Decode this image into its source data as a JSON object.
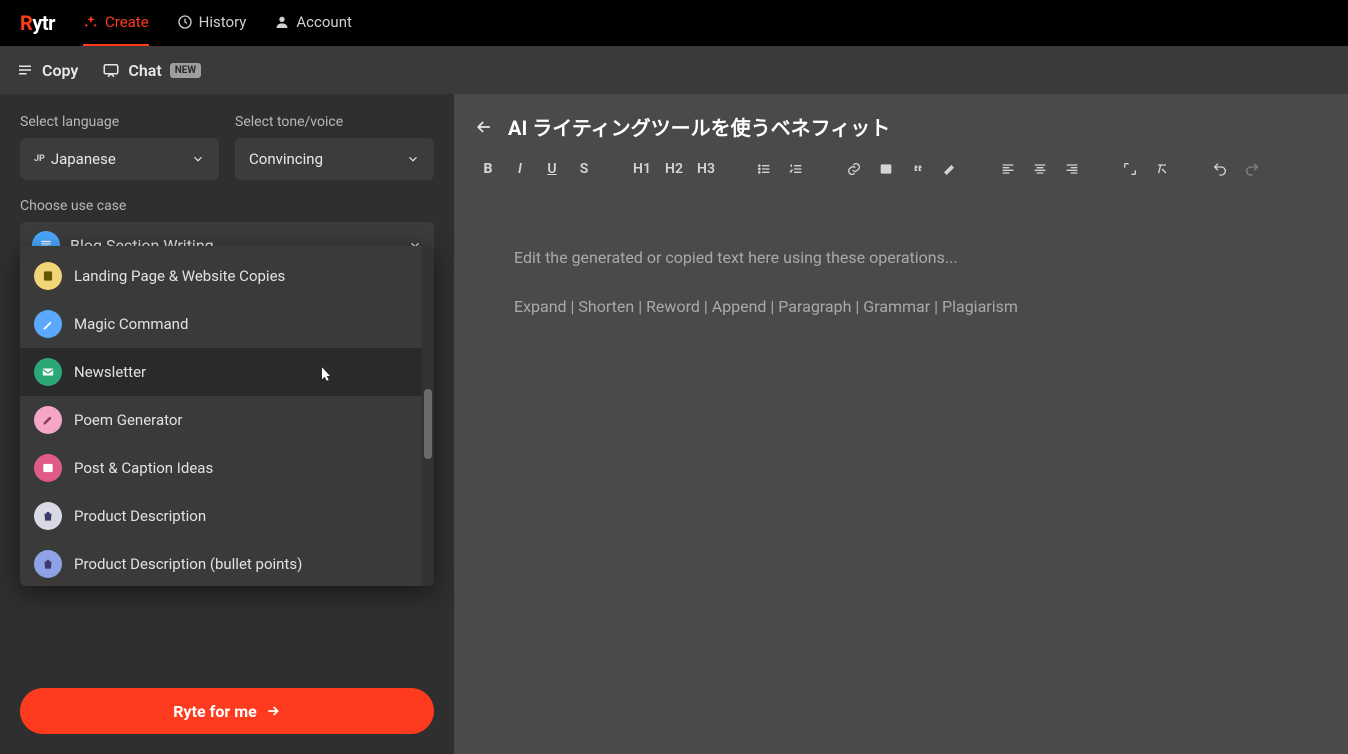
{
  "brand": {
    "name": "Rytr"
  },
  "nav": {
    "tabs": [
      {
        "label": "Create",
        "icon": "sparkle-icon",
        "active": true
      },
      {
        "label": "History",
        "icon": "history-icon",
        "active": false
      },
      {
        "label": "Account",
        "icon": "user-icon",
        "active": false
      }
    ]
  },
  "subnav": {
    "copy_label": "Copy",
    "chat_label": "Chat",
    "chat_badge": "NEW"
  },
  "form": {
    "language_label": "Select language",
    "language_value": "Japanese",
    "language_prefix": "JP",
    "tone_label": "Select tone/voice",
    "tone_value": "Convincing",
    "usecase_label": "Choose use case",
    "usecase_selected": "Blog Section Writing",
    "usecase_icon_bg": "#4aa8ff"
  },
  "dropdown": {
    "items": [
      {
        "label": "Landing Page & Website Copies",
        "icon_bg": "#f2d479",
        "icon": "page-icon"
      },
      {
        "label": "Magic Command",
        "icon_bg": "#5aa9ff",
        "icon": "wand-icon"
      },
      {
        "label": "Newsletter",
        "icon_bg": "#2aa876",
        "icon": "mail-icon",
        "hover": true
      },
      {
        "label": "Poem Generator",
        "icon_bg": "#f4a6c5",
        "icon": "pen-icon"
      },
      {
        "label": "Post & Caption Ideas",
        "icon_bg": "#e05a87",
        "icon": "image-icon"
      },
      {
        "label": "Product Description",
        "icon_bg": "#d9d9e6",
        "icon": "bag-icon"
      },
      {
        "label": "Product Description (bullet points)",
        "icon_bg": "#8fa2e6",
        "icon": "bag-icon"
      }
    ]
  },
  "cta": {
    "label": "Ryte for me"
  },
  "editor": {
    "title": "AI ライティングツールを使うベネフィット",
    "placeholder": "Edit the generated or copied text here using these operations...",
    "ops": "Expand | Shorten | Reword | Append | Paragraph | Grammar | Plagiarism",
    "formats": {
      "bold": "B",
      "italic": "I",
      "underline": "U",
      "strike": "S",
      "h1": "H1",
      "h2": "H2",
      "h3": "H3"
    }
  }
}
